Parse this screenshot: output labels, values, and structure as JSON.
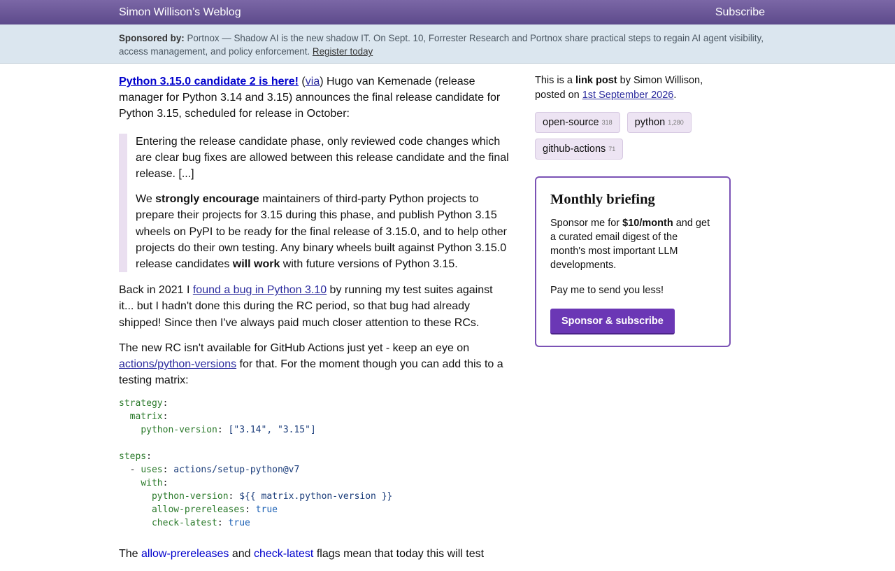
{
  "header": {
    "site_title": "Simon Willison’s Weblog",
    "subscribe": "Subscribe"
  },
  "sponsor": {
    "label": "Sponsored by:",
    "text": "Portnox — Shadow AI is the new shadow IT. On Sept. 10, Forrester Research and Portnox share practical steps to regain AI agent visibility, access management, and policy enforcement.",
    "link": "Register today"
  },
  "post": {
    "title_link": "Python 3.15.0 candidate 2 is here!",
    "via_open": " (",
    "via_link": "via",
    "intro": ") Hugo van Kemenade (release manager for Python 3.14 and 3.15) announces the final release candidate for Python 3.15, scheduled for release in October:",
    "quote1": "Entering the release candidate phase, only reviewed code changes which are clear bug fixes are allowed between this release candidate and the final release. [...]",
    "quote2_a": "We ",
    "quote2_b": "strongly encourage",
    "quote2_c": " maintainers of third-party Python projects to prepare their projects for 3.15 during this phase, and publish Python 3.15 wheels on PyPI to be ready for the final release of 3.15.0, and to help other projects do their own testing. Any binary wheels built against Python 3.15.0 release candidates ",
    "quote2_d": "will work",
    "quote2_e": " with future versions of Python 3.15.",
    "p2_a": "Back in 2021 I ",
    "p2_link": "found a bug in Python 3.10",
    "p2_b": " by running my test suites against it... but I hadn't done this during the RC period, so that bug had already shipped! Since then I've always paid much closer attention to these RCs.",
    "p3_a": "The new RC isn't available for GitHub Actions just yet - keep an eye on ",
    "p3_link": "actions/python-versions",
    "p3_b": " for that. For the moment though you can add this to a testing matrix:",
    "code": {
      "strategy": "strategy",
      "matrix": "matrix",
      "python_version_key": "python-version",
      "python_version_val": "[\"3.14\", \"3.15\"]",
      "steps": "steps",
      "uses": "uses",
      "uses_val": "actions/setup-python@v7",
      "with": "with",
      "python_version_expr": "${{ matrix.python-version }}",
      "allow_prereleases": "allow-prereleases",
      "check_latest": "check-latest",
      "true_val": "true"
    },
    "p4_a": "The ",
    "p4_link1": "allow-prereleases",
    "p4_and": " and ",
    "p4_link2": "check-latest",
    "p4_b": " flags mean that today this will test"
  },
  "sidebar": {
    "meta_a": "This is a ",
    "meta_b": "link post",
    "meta_c": " by Simon Willison, posted on ",
    "meta_date": "1st September 2026",
    "meta_d": ".",
    "tags": [
      {
        "name": "open-source",
        "count": "318"
      },
      {
        "name": "python",
        "count": "1,280"
      },
      {
        "name": "github-actions",
        "count": "71"
      }
    ],
    "briefing": {
      "title": "Monthly briefing",
      "text_a": "Sponsor me for ",
      "text_b": "$10/month",
      "text_c": " and get a curated email digest of the month's most important LLM developments.",
      "text2": "Pay me to send you less!",
      "button": "Sponsor & subscribe"
    }
  }
}
